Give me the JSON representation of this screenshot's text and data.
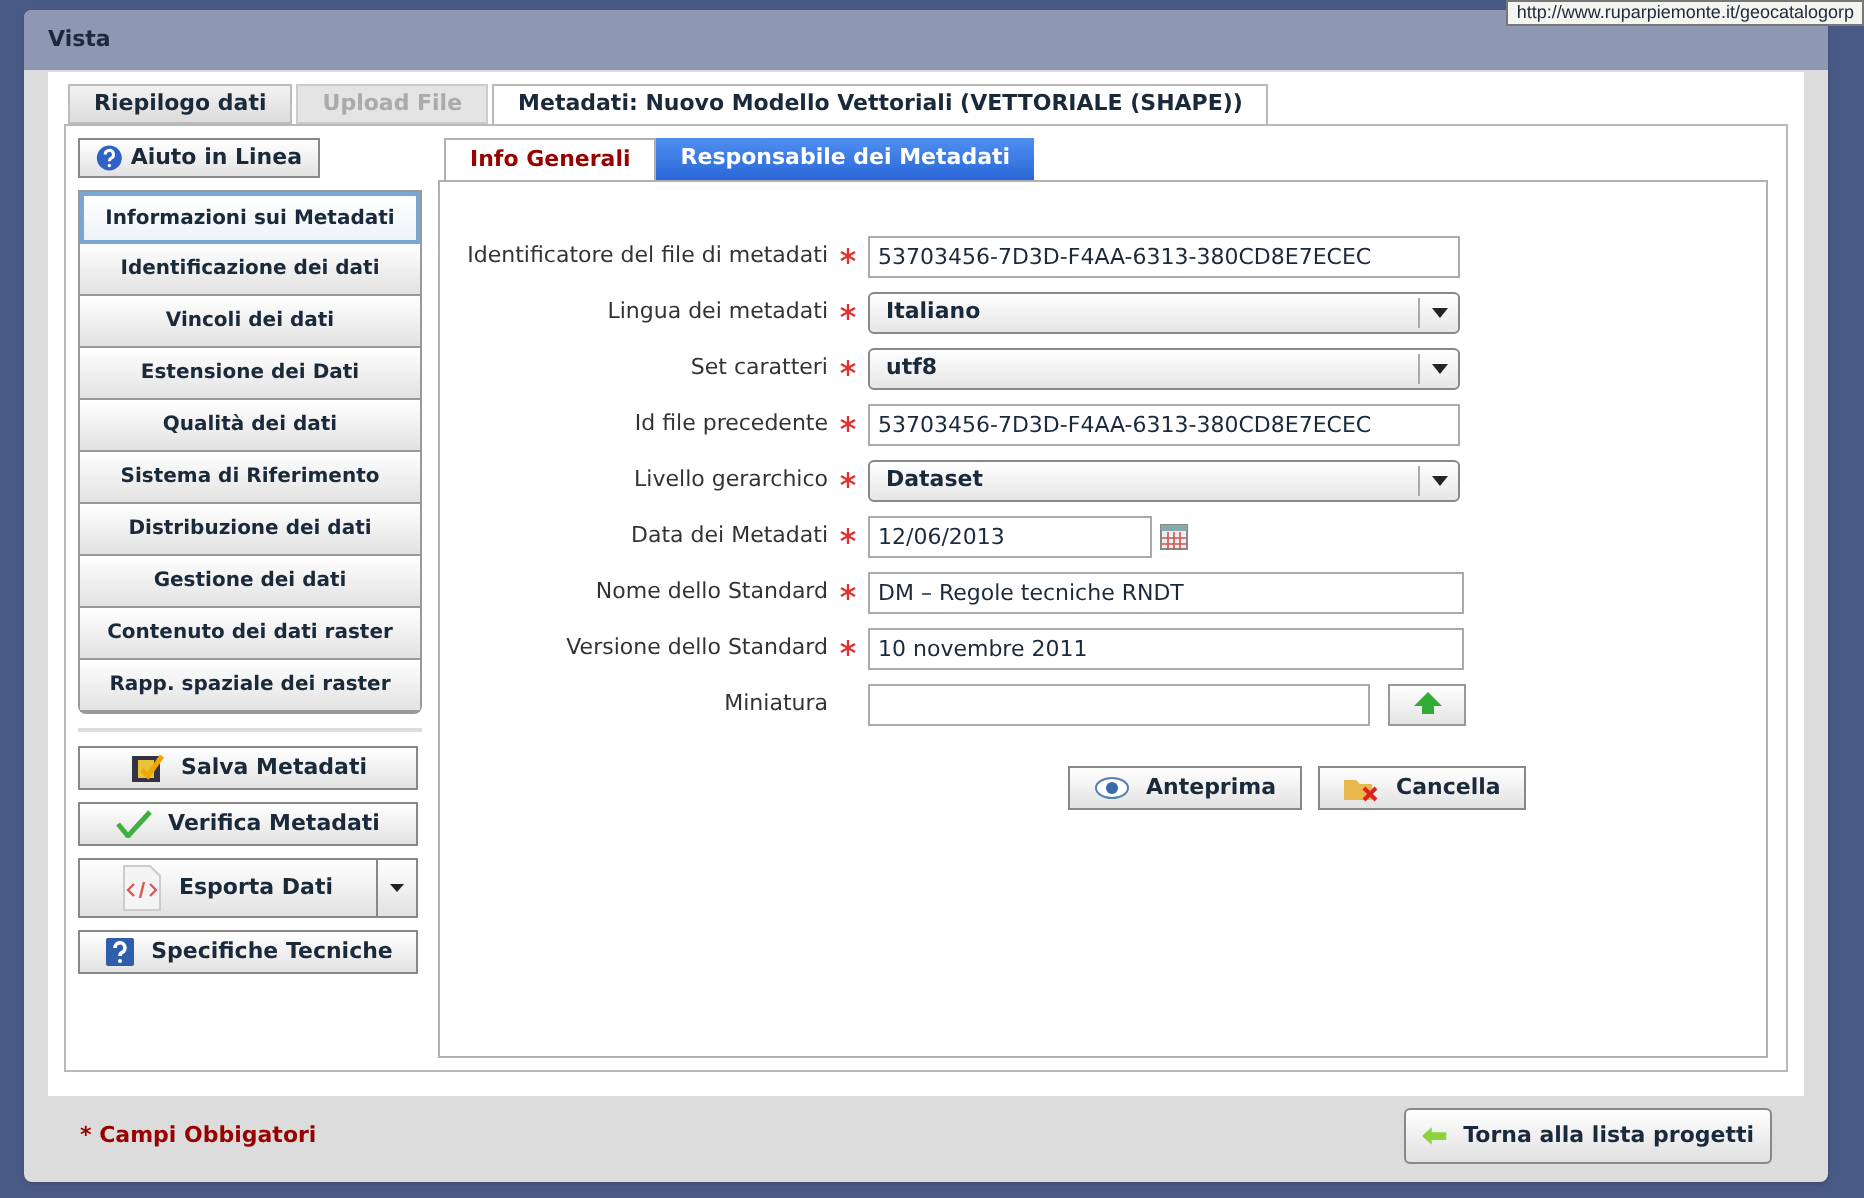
{
  "tooltip": "http://www.ruparpiemonte.it/geocatalogorp",
  "window": {
    "title": "Vista"
  },
  "tabs": [
    {
      "label": "Riepilogo dati",
      "selected": false,
      "disabled": false
    },
    {
      "label": "Upload File",
      "selected": false,
      "disabled": true
    },
    {
      "label": "Metadati: Nuovo Modello Vettoriali (VETTORIALE (SHAPE))",
      "selected": true,
      "disabled": false
    }
  ],
  "help_button": "Aiuto in Linea",
  "sidebar": {
    "items": [
      {
        "label": "Informazioni sui Metadati",
        "selected": true
      },
      {
        "label": "Identificazione dei dati",
        "selected": false
      },
      {
        "label": "Vincoli dei dati",
        "selected": false
      },
      {
        "label": "Estensione dei Dati",
        "selected": false
      },
      {
        "label": "Qualità dei dati",
        "selected": false
      },
      {
        "label": "Sistema di Riferimento",
        "selected": false
      },
      {
        "label": "Distribuzione dei dati",
        "selected": false
      },
      {
        "label": "Gestione dei dati",
        "selected": false
      },
      {
        "label": "Contenuto dei dati raster",
        "selected": false
      },
      {
        "label": "Rapp. spaziale dei raster",
        "selected": false
      }
    ]
  },
  "actions": [
    {
      "label": "Salva Metadati",
      "kind": "save"
    },
    {
      "label": "Verifica Metadati",
      "kind": "verify"
    },
    {
      "label": "Esporta Dati",
      "kind": "export"
    },
    {
      "label": "Specifiche Tecniche",
      "kind": "help"
    }
  ],
  "subtabs": [
    {
      "label": "Info Generali",
      "selected": true
    },
    {
      "label": "Responsabile dei Metadati",
      "selected": false
    }
  ],
  "fields": [
    {
      "label": "Identificatore del file di metadati",
      "required": true,
      "kind": "text",
      "value": "53703456-7D3D-F4AA-6313-380CD8E7ECEC"
    },
    {
      "label": "Lingua dei metadati",
      "required": true,
      "kind": "select",
      "value": "Italiano"
    },
    {
      "label": "Set caratteri",
      "required": true,
      "kind": "select",
      "value": "utf8"
    },
    {
      "label": "Id file precedente",
      "required": true,
      "kind": "text",
      "value": "53703456-7D3D-F4AA-6313-380CD8E7ECEC"
    },
    {
      "label": "Livello gerarchico",
      "required": true,
      "kind": "select",
      "value": "Dataset"
    },
    {
      "label": "Data dei Metadati",
      "required": true,
      "kind": "date",
      "value": "12/06/2013"
    },
    {
      "label": "Nome dello Standard",
      "required": true,
      "kind": "text",
      "value": "DM – Regole tecniche RNDT"
    },
    {
      "label": "Versione dello Standard",
      "required": true,
      "kind": "text",
      "value": "10 novembre 2011"
    },
    {
      "label": "Miniatura",
      "required": false,
      "kind": "file"
    }
  ],
  "form_buttons": [
    {
      "label": "Anteprima",
      "kind": "preview"
    },
    {
      "label": "Cancella",
      "kind": "delete"
    }
  ],
  "footer": {
    "note": "* Campi Obbigatori",
    "back_button": "Torna alla lista progetti"
  }
}
